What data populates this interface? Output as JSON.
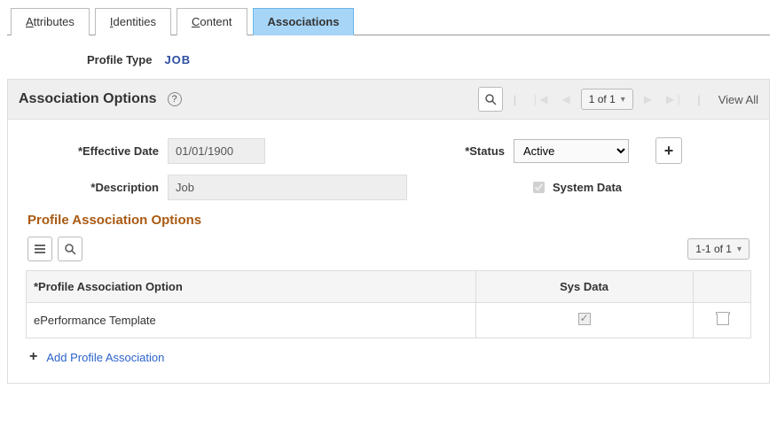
{
  "tabs": {
    "attributes": "ttributes",
    "attributes_ul": "A",
    "identities": "dentities",
    "identities_ul": "I",
    "content": "ontent",
    "content_ul": "C",
    "associations": "Associations"
  },
  "profile_type": {
    "label": "Profile Type",
    "value": "JOB"
  },
  "assoc_panel": {
    "title": "Association Options",
    "pager": "1 of 1",
    "view_all": "View All"
  },
  "form": {
    "eff_date_label": "*Effective Date",
    "eff_date_value": "01/01/1900",
    "status_label": "*Status",
    "status_value": "Active",
    "desc_label": "*Description",
    "desc_value": "Job",
    "system_data": "System Data"
  },
  "pao": {
    "title": "Profile Association Options",
    "pager": "1-1 of 1",
    "col_option": "*Profile Association Option",
    "col_sys": "Sys Data",
    "rows": [
      {
        "option": "ePerformance Template",
        "sys": true
      }
    ],
    "add_link": "Add Profile Association"
  }
}
